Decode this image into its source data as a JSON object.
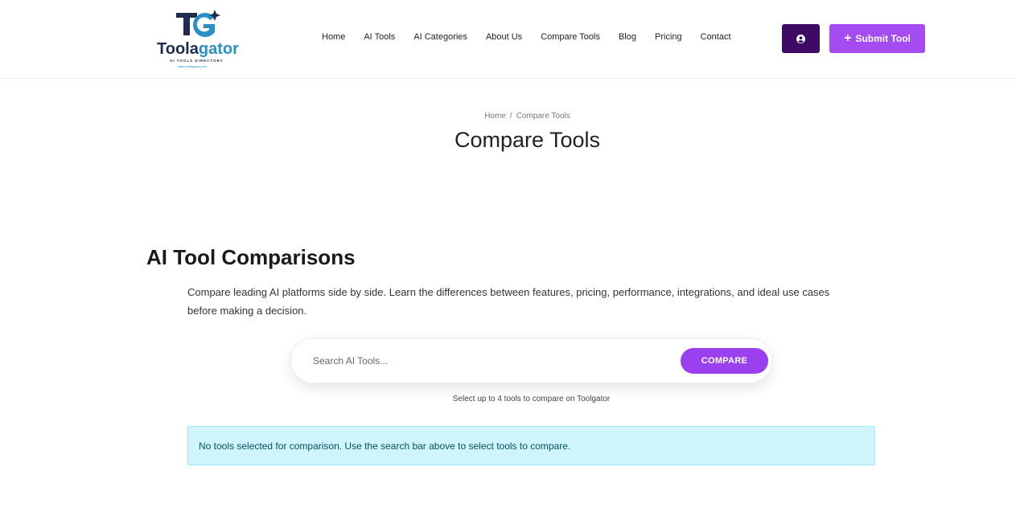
{
  "brand": {
    "name_part1": "Toola",
    "name_part2": "gator",
    "tagline": "AI TOOLS DIRECTORY",
    "url": "www.toolagator.com",
    "colors": {
      "dark": "#1e2d4f",
      "accent": "#2a8fc4"
    }
  },
  "nav": {
    "items": [
      {
        "label": "Home"
      },
      {
        "label": "AI Tools"
      },
      {
        "label": "AI Categories"
      },
      {
        "label": "About Us"
      },
      {
        "label": "Compare Tools"
      },
      {
        "label": "Blog"
      },
      {
        "label": "Pricing"
      },
      {
        "label": "Contact"
      }
    ]
  },
  "header_actions": {
    "user_icon": "user-circle-icon",
    "submit_label": "Submit Tool",
    "submit_icon": "plus-icon",
    "colors": {
      "user_button": "#3e0a63",
      "submit_button": "#a44cf2"
    }
  },
  "breadcrumb": {
    "home": "Home",
    "separator": "/",
    "current": "Compare Tools"
  },
  "page": {
    "title": "Compare Tools"
  },
  "comparisons": {
    "heading": "AI Tool Comparisons",
    "description": "Compare leading AI platforms side by side. Learn the differences between features, pricing, performance, integrations, and ideal use cases before making a decision."
  },
  "search": {
    "placeholder": "Search AI Tools...",
    "value": "",
    "button_label": "COMPARE",
    "hint": "Select up to 4 tools to compare on Toolgator",
    "button_color": "#9a40ef"
  },
  "alert": {
    "message": "No tools selected for comparison. Use the search bar above to select tools to compare.",
    "background": "#cff4fc"
  }
}
